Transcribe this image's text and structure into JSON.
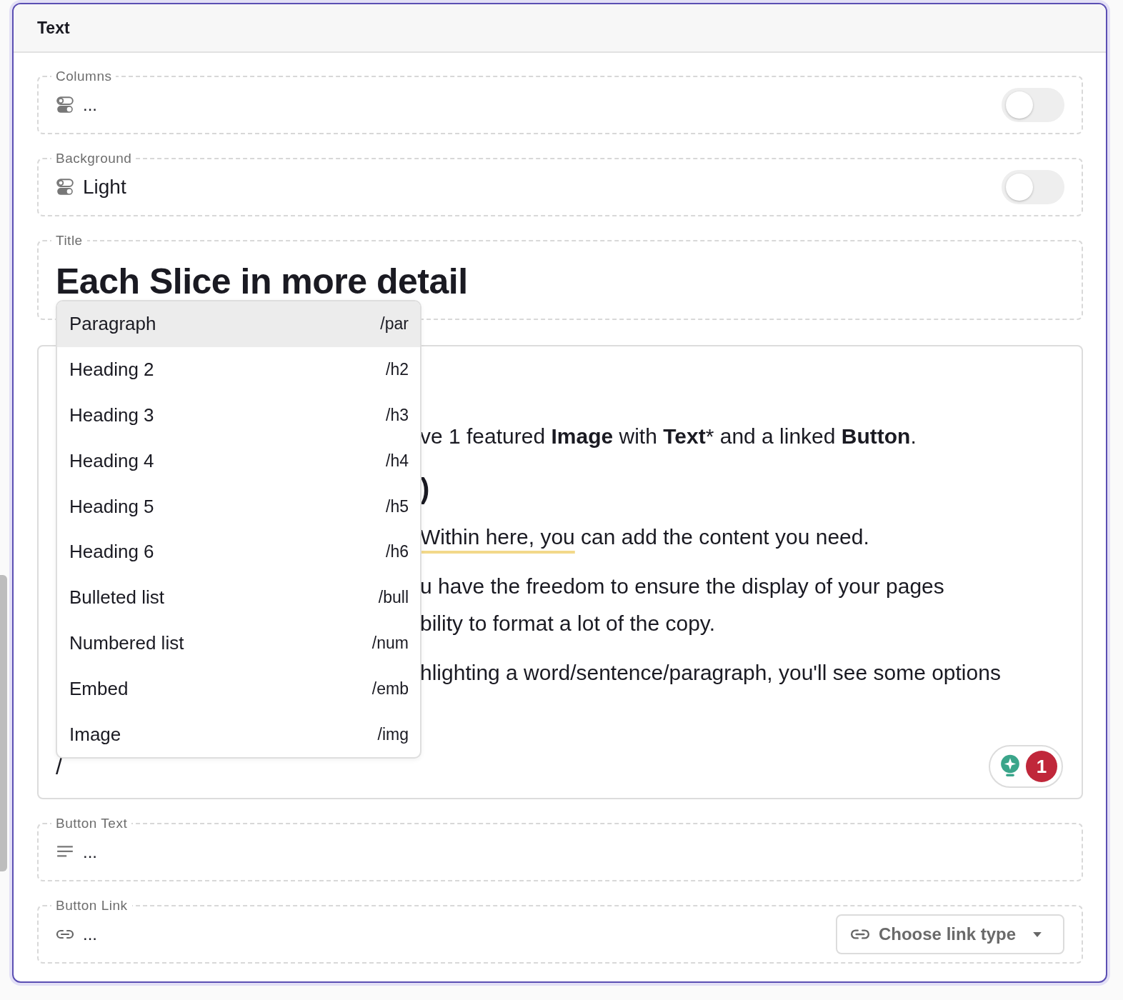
{
  "panel": {
    "title": "Text"
  },
  "fields": [
    {
      "kind": "toggle",
      "label": "Columns",
      "value": "...",
      "on": false
    },
    {
      "kind": "toggle",
      "label": "Background",
      "value": "Light",
      "on": false
    },
    {
      "kind": "title",
      "label": "Title",
      "value": "Each Slice in more detail"
    },
    {
      "kind": "richtext",
      "typed": "/",
      "issues": "1",
      "paragraphs": [
        {
          "kind": "text",
          "lines": [
            "ve 1 featured **Image** with **Text*** and a linked **Button**."
          ]
        },
        {
          "kind": "heading",
          "lines": [
            ")"
          ]
        },
        {
          "kind": "marked",
          "marked": "Within here, you",
          "lines": [
            " can add the content you need."
          ]
        },
        {
          "kind": "text",
          "lines": [
            "u have the freedom to ensure the display of your pages",
            "bility to format a lot of the copy."
          ]
        },
        {
          "kind": "text",
          "lines": [
            "hlighting a word/sentence/paragraph, you'll see some options"
          ]
        }
      ]
    },
    {
      "kind": "text",
      "label": "Button Text",
      "value": "..."
    },
    {
      "kind": "link",
      "label": "Button Link",
      "value": "...",
      "button": "Choose link type"
    }
  ],
  "menu": {
    "items": [
      {
        "label": "Paragraph",
        "shortcut": "/par",
        "selected": true
      },
      {
        "label": "Heading 2",
        "shortcut": "/h2",
        "selected": false
      },
      {
        "label": "Heading 3",
        "shortcut": "/h3",
        "selected": false
      },
      {
        "label": "Heading 4",
        "shortcut": "/h4",
        "selected": false
      },
      {
        "label": "Heading 5",
        "shortcut": "/h5",
        "selected": false
      },
      {
        "label": "Heading 6",
        "shortcut": "/h6",
        "selected": false
      },
      {
        "label": "Bulleted list",
        "shortcut": "/bull",
        "selected": false
      },
      {
        "label": "Numbered list",
        "shortcut": "/num",
        "selected": false
      },
      {
        "label": "Embed",
        "shortcut": "/emb",
        "selected": false
      },
      {
        "label": "Image",
        "shortcut": "/img",
        "selected": false
      }
    ]
  }
}
